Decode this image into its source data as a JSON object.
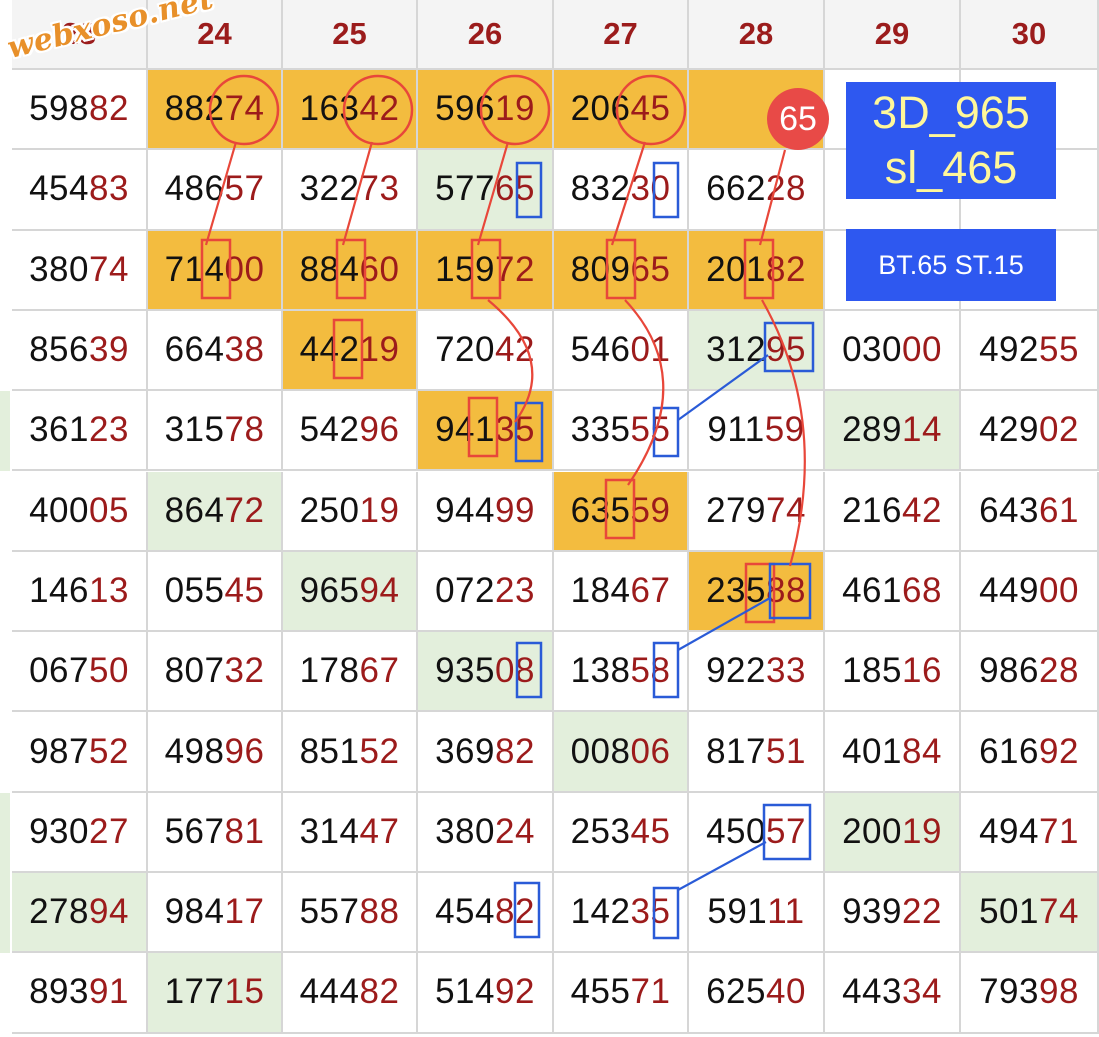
{
  "watermark": "webxoso.net",
  "headers": [
    "23",
    "24",
    "25",
    "26",
    "27",
    "28",
    "29",
    "30"
  ],
  "rows": [
    [
      "59882",
      "88274",
      "16342",
      "59619",
      "20645",
      "",
      "",
      ""
    ],
    [
      "45483",
      "48657",
      "32273",
      "57765",
      "83230",
      "66228",
      "",
      "",
      ""
    ],
    [
      "38074",
      "71400",
      "88460",
      "15972",
      "80965",
      "20182",
      "",
      ""
    ],
    [
      "85639",
      "66438",
      "44219",
      "72042",
      "54601",
      "31295",
      "03000",
      "49255"
    ],
    [
      "36123",
      "31578",
      "54296",
      "94135",
      "33555",
      "91159",
      "28914",
      "42902"
    ],
    [
      "40005",
      "86472",
      "25019",
      "94499",
      "63559",
      "27974",
      "21642",
      "64361"
    ],
    [
      "14613",
      "05545",
      "96594",
      "07223",
      "18467",
      "23588",
      "46168",
      "44900"
    ],
    [
      "06750",
      "80732",
      "17867",
      "93508",
      "13858",
      "92233",
      "18516",
      "98628"
    ],
    [
      "98752",
      "49896",
      "85152",
      "36982",
      "00806",
      "81751",
      "40184",
      "61692"
    ],
    [
      "93027",
      "56781",
      "31447",
      "38024",
      "25345",
      "45057",
      "20019",
      "49471"
    ],
    [
      "27894",
      "98417",
      "55788",
      "45482",
      "14235",
      "59111",
      "93922",
      "50174"
    ],
    [
      "89391",
      "17715",
      "44482",
      "51492",
      "45571",
      "62540",
      "44334",
      "79398"
    ]
  ],
  "cell_fill": [
    [
      "normal",
      "orange",
      "orange",
      "orange",
      "orange",
      "orange",
      "normal",
      "normal"
    ],
    [
      "normal",
      "normal",
      "normal",
      "green",
      "normal",
      "normal",
      "normal",
      "normal"
    ],
    [
      "normal",
      "orange",
      "orange",
      "orange",
      "orange",
      "orange",
      "normal",
      "normal"
    ],
    [
      "normal",
      "normal",
      "orange",
      "normal",
      "normal",
      "green",
      "normal",
      "normal"
    ],
    [
      "normal",
      "normal",
      "normal",
      "orange",
      "normal",
      "normal",
      "green",
      "normal"
    ],
    [
      "normal",
      "green",
      "normal",
      "normal",
      "orange",
      "normal",
      "normal",
      "normal"
    ],
    [
      "normal",
      "normal",
      "green",
      "normal",
      "normal",
      "orange",
      "normal",
      "normal"
    ],
    [
      "normal",
      "normal",
      "normal",
      "green",
      "normal",
      "normal",
      "normal",
      "normal"
    ],
    [
      "normal",
      "normal",
      "normal",
      "normal",
      "green",
      "normal",
      "normal",
      "normal"
    ],
    [
      "normal",
      "normal",
      "normal",
      "normal",
      "normal",
      "normal",
      "green",
      "normal"
    ],
    [
      "green",
      "normal",
      "normal",
      "normal",
      "normal",
      "normal",
      "normal",
      "green"
    ],
    [
      "normal",
      "green",
      "normal",
      "normal",
      "normal",
      "normal",
      "normal",
      "normal"
    ]
  ],
  "badge": "65",
  "info_box": {
    "line1": "3D_965",
    "line2": "sl_465"
  },
  "bt_st": "BT.65 ST.15",
  "colors": {
    "orange_fill": "#f3bc3f",
    "green_fill": "#e3efdc",
    "tail_digits": "#9c1b1b",
    "header_text": "#9b1c1c",
    "marker_red": "#e8473a",
    "marker_blue": "#2a5bd7",
    "info_box_bg": "#2e58f0",
    "info_box_text": "#fff79a",
    "badge_bg": "#e84a47"
  }
}
